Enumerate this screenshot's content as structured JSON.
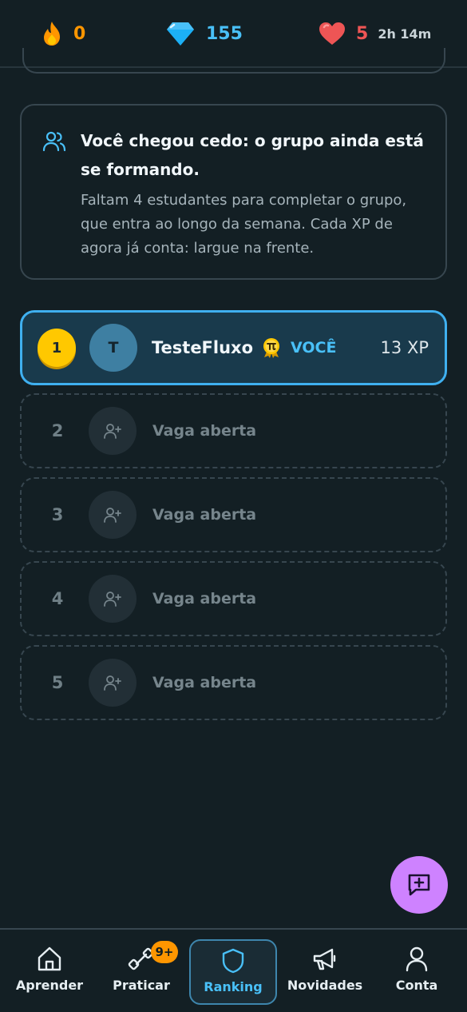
{
  "stats": {
    "streak": "0",
    "gems": "155",
    "hearts": "5",
    "heart_timer": "2h 14m",
    "streak_color": "#ff9600",
    "gems_color": "#49c0f8",
    "hearts_color": "#ee5555"
  },
  "info_card": {
    "icon": "users-icon",
    "title": "Você chegou cedo: o grupo ainda está se formando.",
    "text": "Faltam 4 estudantes para completar o grupo, que entra ao longo da semana. Cada XP de agora já conta: largue na frente."
  },
  "leaderboard": {
    "me": {
      "rank": "1",
      "avatar_initial": "T",
      "name": "TesteFluxo",
      "badge_icon": "pi-medal-icon",
      "you_label": "VOCÊ",
      "xp": "13 XP"
    },
    "open_slots": [
      {
        "rank": "2",
        "label": "Vaga aberta"
      },
      {
        "rank": "3",
        "label": "Vaga aberta"
      },
      {
        "rank": "4",
        "label": "Vaga aberta"
      },
      {
        "rank": "5",
        "label": "Vaga aberta"
      }
    ]
  },
  "fab": {
    "icon": "chat-plus-icon",
    "color": "#ce82ff"
  },
  "nav": {
    "items": [
      {
        "label": "Aprender",
        "icon": "home-icon"
      },
      {
        "label": "Praticar",
        "icon": "dumbbell-icon",
        "badge": "9+"
      },
      {
        "label": "Ranking",
        "icon": "shield-icon",
        "active": true
      },
      {
        "label": "Novidades",
        "icon": "megaphone-icon"
      },
      {
        "label": "Conta",
        "icon": "user-icon"
      }
    ]
  }
}
